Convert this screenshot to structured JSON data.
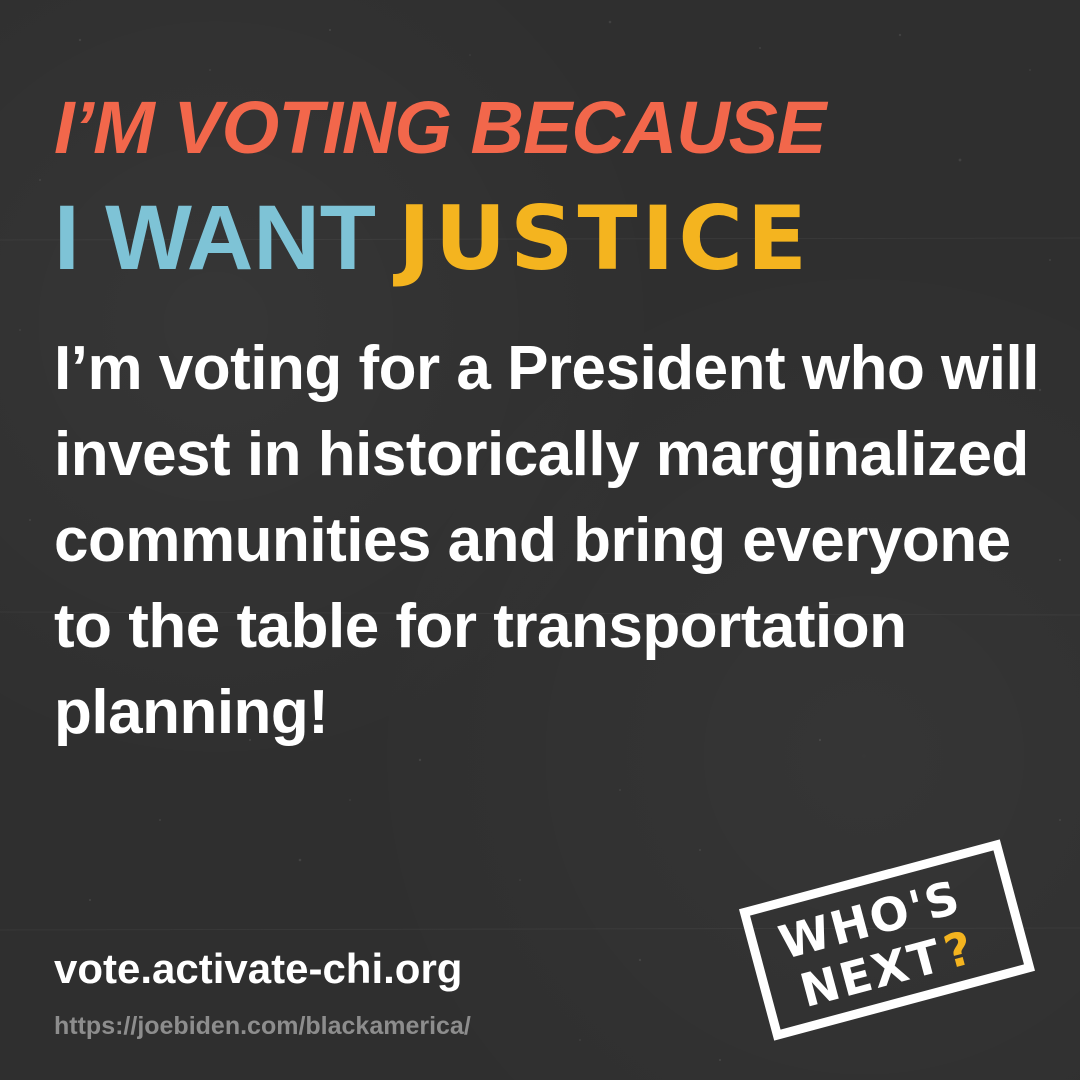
{
  "headline": {
    "line1": "I’M VOTING BECAUSE",
    "line2_part1": "I WANT",
    "line2_part2": "JUSTICE"
  },
  "body": "I’m voting for a President who will invest in historically marginalized communities and bring everyone to the table for transportation planning!",
  "footer": {
    "site": "vote.activate-chi.org",
    "source": "https://joebiden.com/blackamerica/"
  },
  "logo": {
    "line1": "WHO'S",
    "line2": "NEXT",
    "mark": "?",
    "icon": "whos-next-stamp-logo"
  },
  "colors": {
    "background": "#2f2f2f",
    "headline1": "#f2674b",
    "want": "#7ec3d6",
    "justice": "#f4b41f",
    "text": "#ffffff",
    "muted": "#8d8d8d"
  }
}
